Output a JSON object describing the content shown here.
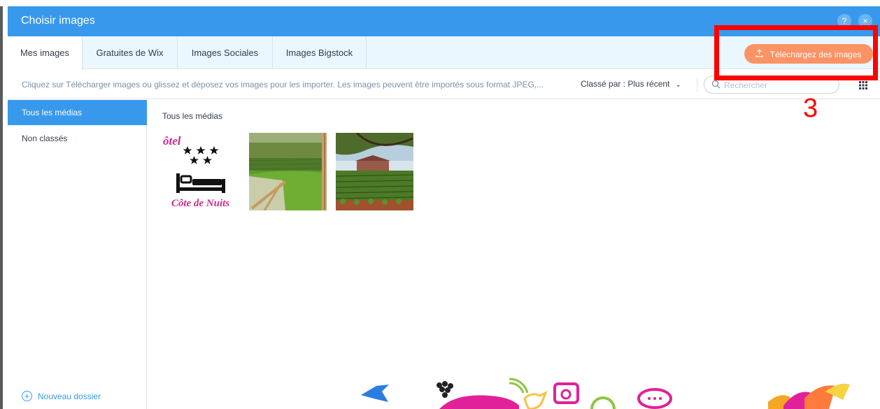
{
  "dialog": {
    "title": "Choisir images",
    "help_label": "?",
    "close_label": "×"
  },
  "tabs": [
    {
      "label": "Mes images",
      "active": true
    },
    {
      "label": "Gratuites de Wix",
      "active": false
    },
    {
      "label": "Images Sociales",
      "active": false
    },
    {
      "label": "Images Bigstock",
      "active": false
    }
  ],
  "upload_button": {
    "label": "Téléchargez des images",
    "icon": "upload-icon"
  },
  "toolbar": {
    "hint": "Cliquez sur Télécharger images ou glissez et déposez vos images pour les importer. Les images peuvent être importés sous format JPEG,...",
    "sort_label": "Classé par : Plus récent",
    "search_placeholder": "Rechercher",
    "view_icon": "grid-icon"
  },
  "sidebar": {
    "items": [
      {
        "label": "Tous les médias",
        "active": true
      },
      {
        "label": "Non classés",
        "active": false
      }
    ],
    "new_folder_label": "Nouveau dossier"
  },
  "content": {
    "section_title": "Tous les médias",
    "thumbnails": [
      {
        "name": "hotel-logo",
        "logo_top": "ôtel",
        "logo_bottom": "Côte de Nuits"
      },
      {
        "name": "vineyard-deckchair"
      },
      {
        "name": "vineyard-chateau"
      }
    ]
  },
  "annotation": {
    "number": "3",
    "color": "#ff0000"
  },
  "colors": {
    "accent": "#3899ec",
    "upload": "#fb9365",
    "tab_bar": "#eaf7ff",
    "hint_text": "#7a92a5"
  }
}
